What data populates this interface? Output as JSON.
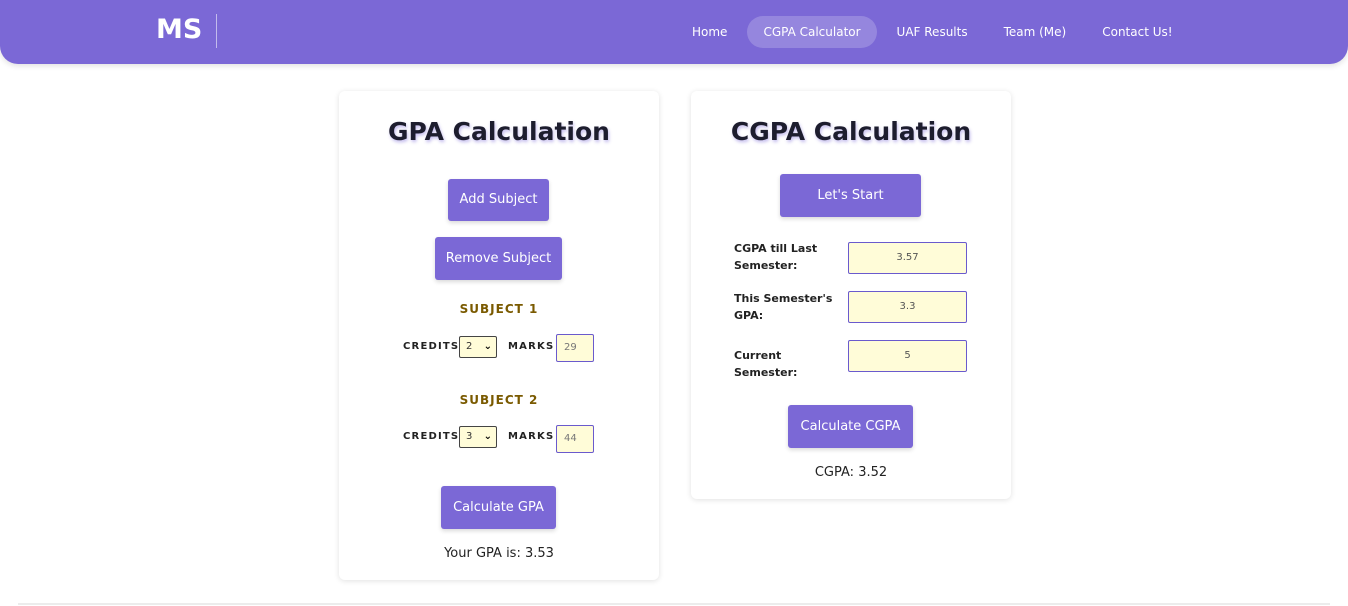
{
  "nav": {
    "logo": "MS",
    "links": [
      "Home",
      "CGPA Calculator",
      "UAF Results",
      "Team (Me)",
      "Contact Us!"
    ],
    "active": "CGPA Calculator"
  },
  "gpa": {
    "title": "GPA Calculation",
    "add_label": "Add Subject",
    "remove_label": "Remove Subject",
    "credits_label": "CREDITS",
    "marks_label": "MARKS",
    "subjects": [
      {
        "title": "SUBJECT 1",
        "credits": "2",
        "marks": "29"
      },
      {
        "title": "SUBJECT 2",
        "credits": "3",
        "marks": "44"
      }
    ],
    "calculate_label": "Calculate GPA",
    "result": "Your GPA is: 3.53"
  },
  "cgpa": {
    "title": "CGPA Calculation",
    "start_label": "Let's Start",
    "last_label": "CGPA till Last Semester:",
    "last_value": "3.57",
    "this_label": "This Semester's GPA:",
    "this_value": "3.3",
    "current_label": "Current Semester:",
    "current_value": "5",
    "calculate_label": "Calculate CGPA",
    "result": "CGPA: 3.52"
  },
  "colors": {
    "primary": "#7b68d6",
    "input_bg": "#fffcd8",
    "subject_title": "#7a5a00"
  }
}
